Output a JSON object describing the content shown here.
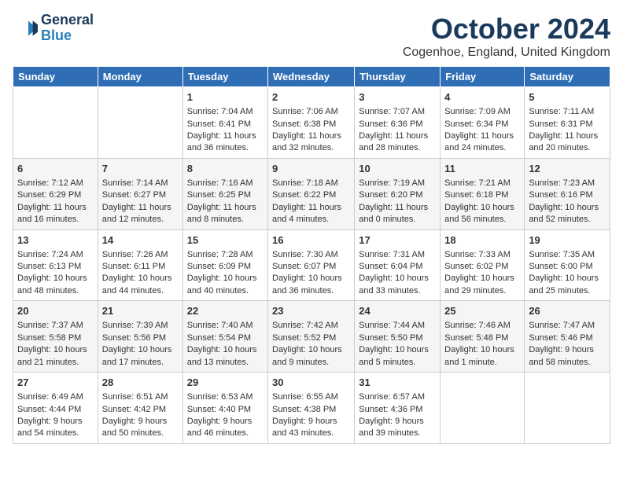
{
  "logo": {
    "line1": "General",
    "line2": "Blue"
  },
  "title": "October 2024",
  "subtitle": "Cogenhoe, England, United Kingdom",
  "days_of_week": [
    "Sunday",
    "Monday",
    "Tuesday",
    "Wednesday",
    "Thursday",
    "Friday",
    "Saturday"
  ],
  "weeks": [
    [
      {
        "day": "",
        "content": ""
      },
      {
        "day": "",
        "content": ""
      },
      {
        "day": "1",
        "content": "Sunrise: 7:04 AM\nSunset: 6:41 PM\nDaylight: 11 hours and 36 minutes."
      },
      {
        "day": "2",
        "content": "Sunrise: 7:06 AM\nSunset: 6:38 PM\nDaylight: 11 hours and 32 minutes."
      },
      {
        "day": "3",
        "content": "Sunrise: 7:07 AM\nSunset: 6:36 PM\nDaylight: 11 hours and 28 minutes."
      },
      {
        "day": "4",
        "content": "Sunrise: 7:09 AM\nSunset: 6:34 PM\nDaylight: 11 hours and 24 minutes."
      },
      {
        "day": "5",
        "content": "Sunrise: 7:11 AM\nSunset: 6:31 PM\nDaylight: 11 hours and 20 minutes."
      }
    ],
    [
      {
        "day": "6",
        "content": "Sunrise: 7:12 AM\nSunset: 6:29 PM\nDaylight: 11 hours and 16 minutes."
      },
      {
        "day": "7",
        "content": "Sunrise: 7:14 AM\nSunset: 6:27 PM\nDaylight: 11 hours and 12 minutes."
      },
      {
        "day": "8",
        "content": "Sunrise: 7:16 AM\nSunset: 6:25 PM\nDaylight: 11 hours and 8 minutes."
      },
      {
        "day": "9",
        "content": "Sunrise: 7:18 AM\nSunset: 6:22 PM\nDaylight: 11 hours and 4 minutes."
      },
      {
        "day": "10",
        "content": "Sunrise: 7:19 AM\nSunset: 6:20 PM\nDaylight: 11 hours and 0 minutes."
      },
      {
        "day": "11",
        "content": "Sunrise: 7:21 AM\nSunset: 6:18 PM\nDaylight: 10 hours and 56 minutes."
      },
      {
        "day": "12",
        "content": "Sunrise: 7:23 AM\nSunset: 6:16 PM\nDaylight: 10 hours and 52 minutes."
      }
    ],
    [
      {
        "day": "13",
        "content": "Sunrise: 7:24 AM\nSunset: 6:13 PM\nDaylight: 10 hours and 48 minutes."
      },
      {
        "day": "14",
        "content": "Sunrise: 7:26 AM\nSunset: 6:11 PM\nDaylight: 10 hours and 44 minutes."
      },
      {
        "day": "15",
        "content": "Sunrise: 7:28 AM\nSunset: 6:09 PM\nDaylight: 10 hours and 40 minutes."
      },
      {
        "day": "16",
        "content": "Sunrise: 7:30 AM\nSunset: 6:07 PM\nDaylight: 10 hours and 36 minutes."
      },
      {
        "day": "17",
        "content": "Sunrise: 7:31 AM\nSunset: 6:04 PM\nDaylight: 10 hours and 33 minutes."
      },
      {
        "day": "18",
        "content": "Sunrise: 7:33 AM\nSunset: 6:02 PM\nDaylight: 10 hours and 29 minutes."
      },
      {
        "day": "19",
        "content": "Sunrise: 7:35 AM\nSunset: 6:00 PM\nDaylight: 10 hours and 25 minutes."
      }
    ],
    [
      {
        "day": "20",
        "content": "Sunrise: 7:37 AM\nSunset: 5:58 PM\nDaylight: 10 hours and 21 minutes."
      },
      {
        "day": "21",
        "content": "Sunrise: 7:39 AM\nSunset: 5:56 PM\nDaylight: 10 hours and 17 minutes."
      },
      {
        "day": "22",
        "content": "Sunrise: 7:40 AM\nSunset: 5:54 PM\nDaylight: 10 hours and 13 minutes."
      },
      {
        "day": "23",
        "content": "Sunrise: 7:42 AM\nSunset: 5:52 PM\nDaylight: 10 hours and 9 minutes."
      },
      {
        "day": "24",
        "content": "Sunrise: 7:44 AM\nSunset: 5:50 PM\nDaylight: 10 hours and 5 minutes."
      },
      {
        "day": "25",
        "content": "Sunrise: 7:46 AM\nSunset: 5:48 PM\nDaylight: 10 hours and 1 minute."
      },
      {
        "day": "26",
        "content": "Sunrise: 7:47 AM\nSunset: 5:46 PM\nDaylight: 9 hours and 58 minutes."
      }
    ],
    [
      {
        "day": "27",
        "content": "Sunrise: 6:49 AM\nSunset: 4:44 PM\nDaylight: 9 hours and 54 minutes."
      },
      {
        "day": "28",
        "content": "Sunrise: 6:51 AM\nSunset: 4:42 PM\nDaylight: 9 hours and 50 minutes."
      },
      {
        "day": "29",
        "content": "Sunrise: 6:53 AM\nSunset: 4:40 PM\nDaylight: 9 hours and 46 minutes."
      },
      {
        "day": "30",
        "content": "Sunrise: 6:55 AM\nSunset: 4:38 PM\nDaylight: 9 hours and 43 minutes."
      },
      {
        "day": "31",
        "content": "Sunrise: 6:57 AM\nSunset: 4:36 PM\nDaylight: 9 hours and 39 minutes."
      },
      {
        "day": "",
        "content": ""
      },
      {
        "day": "",
        "content": ""
      }
    ]
  ]
}
